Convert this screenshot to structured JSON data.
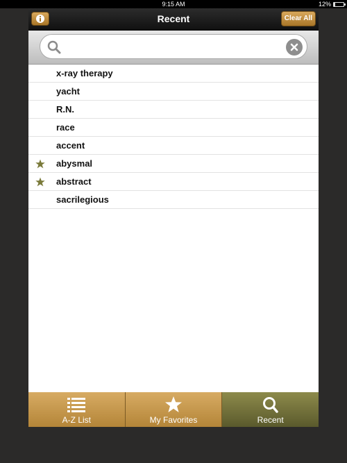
{
  "status_bar": {
    "time": "9:15 AM",
    "battery": "12%"
  },
  "nav": {
    "title": "Recent",
    "info_icon": "info-icon",
    "clear_label": "Clear All"
  },
  "search": {
    "value": "",
    "placeholder": "",
    "icon": "search-icon",
    "clear_icon": "clear-search-icon"
  },
  "recent_items": [
    {
      "label": "x-ray therapy",
      "favorite": false
    },
    {
      "label": "yacht",
      "favorite": false
    },
    {
      "label": "R.N.",
      "favorite": false
    },
    {
      "label": "race",
      "favorite": false
    },
    {
      "label": "accent",
      "favorite": false
    },
    {
      "label": "abysmal",
      "favorite": true
    },
    {
      "label": "abstract",
      "favorite": true
    },
    {
      "label": "sacrilegious",
      "favorite": false
    }
  ],
  "tabs": [
    {
      "label": "A-Z List",
      "icon": "list-icon",
      "active": false
    },
    {
      "label": "My Favorites",
      "icon": "star-icon",
      "active": false
    },
    {
      "label": "Recent",
      "icon": "search-icon",
      "active": true
    }
  ],
  "colors": {
    "accent_gold": "#c89a4d",
    "active_tab": "#6f6c3a",
    "favorite_star": "#7a7a3a"
  }
}
